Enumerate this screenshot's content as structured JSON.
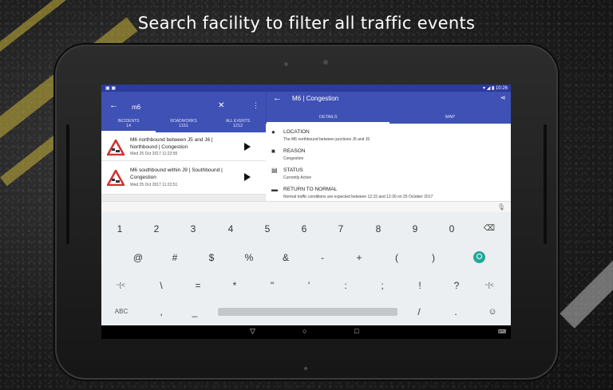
{
  "promo": {
    "headline": "Search facility to filter all traffic events"
  },
  "statusbar": {
    "left_icons": "▣ ▣",
    "right": "▾ ◢ ▮ 10:26"
  },
  "search": {
    "back_icon": "back-arrow-icon",
    "value": "m6",
    "clear_icon": "close-icon",
    "menu_icon": "more-vert-icon"
  },
  "tabs": [
    {
      "label": "INCIDENTS",
      "count": "14"
    },
    {
      "label": "ROADWORKS",
      "count": "1151"
    },
    {
      "label": "ALL EVENTS",
      "count": "1212"
    }
  ],
  "events": [
    {
      "title": "M6 northbound between J5 and J6 | Northbound | Congestion",
      "time": "Wed 25 Oct 2017 11:22:55"
    },
    {
      "title": "M6 southbound within J9 | Southbound | Congestion",
      "time": "Wed 25 Oct 2017 11:22:51"
    }
  ],
  "detail_header": {
    "title": "M6 | Congestion",
    "share_icon": "share-icon"
  },
  "detail_tabs": [
    "DETAILS",
    "MAP"
  ],
  "details": [
    {
      "icon": "location-pin-icon",
      "heading": "LOCATION",
      "text": "The M6 northbound between junctions J5 and J6"
    },
    {
      "icon": "chat-bubble-icon",
      "heading": "REASON",
      "text": "Congestion"
    },
    {
      "icon": "status-message-icon",
      "heading": "STATUS",
      "text": "Currently Active"
    },
    {
      "icon": "car-icon",
      "heading": "RETURN TO NORMAL",
      "text": "Normal traffic conditions are expected between 12:15 and 12:30 on 25 October 2017"
    }
  ],
  "keyboard": {
    "row1": [
      "1",
      "2",
      "3",
      "4",
      "5",
      "6",
      "7",
      "8",
      "9",
      "0"
    ],
    "row2": [
      "@",
      "#",
      "$",
      "%",
      "&",
      "-",
      "+",
      "(",
      ")"
    ],
    "row3": [
      "~[<",
      "\\",
      "=",
      "*",
      "\"",
      "'",
      ":",
      ";",
      "!",
      "?",
      "~[<"
    ],
    "row4": [
      "ABC",
      ",",
      "_",
      "/",
      "."
    ],
    "backspace_icon": "backspace-icon",
    "search_icon": "search-icon",
    "emoji_icon": "emoji-icon",
    "mic_icon": "mic-icon"
  },
  "navbar": {
    "back": "▽",
    "home": "○",
    "recents": "□",
    "keyboard_icon": "keyboard-icon"
  },
  "colors": {
    "primary": "#3f51b5",
    "status": "#2c3a9c",
    "accent_teal": "#26a69a"
  }
}
